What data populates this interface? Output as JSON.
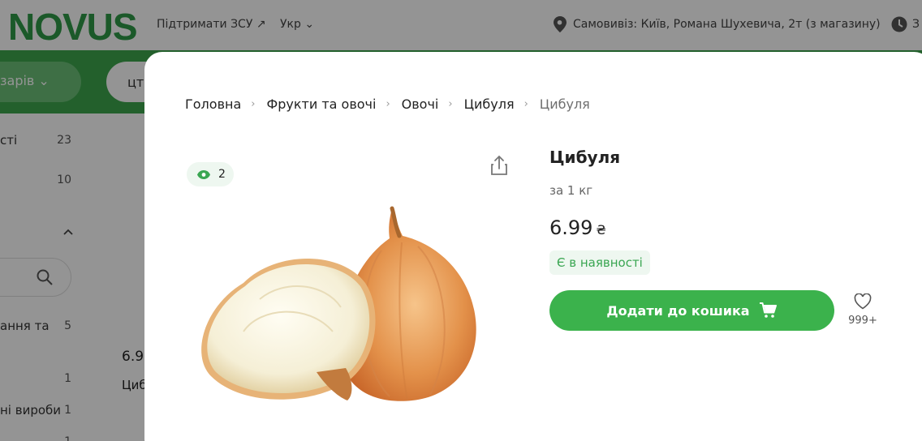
{
  "header": {
    "logo": "NOVUS",
    "support_link": "Підтримати ЗСУ ↗",
    "language": "Укр ⌄",
    "pickup": "Самовивіз: Київ, Романа Шухевича, 2т (з магазину)",
    "time_label": "З"
  },
  "catalog": {
    "catalog_button": "зарів ⌄",
    "search_text": "цт"
  },
  "sidebar": {
    "items": [
      {
        "label": "сті",
        "count": "23"
      },
      {
        "label": "",
        "count": "10"
      },
      {
        "label": "ання та",
        "count": "5"
      },
      {
        "label": "",
        "count": "1"
      },
      {
        "label": "ні вироби",
        "count": "1"
      },
      {
        "label": "",
        "count": "1"
      }
    ]
  },
  "background_card": {
    "price": "6.9",
    "name": "Циб"
  },
  "breadcrumb": [
    {
      "label": "Головна"
    },
    {
      "label": "Фрукти та овочі"
    },
    {
      "label": "Овочі"
    },
    {
      "label": "Цибуля"
    },
    {
      "label": "Цибуля"
    }
  ],
  "product": {
    "views": "2",
    "title": "Цибуля",
    "unit": "за 1 кг",
    "price": "6.99",
    "currency": "₴",
    "stock": "Є в наявності",
    "add_to_cart": "Додати до кошика",
    "favorites_count": "999+"
  },
  "icons": [
    "location-icon",
    "clock-icon",
    "search-icon",
    "eye-icon",
    "share-icon",
    "cart-icon",
    "heart-icon",
    "chevron-up-icon"
  ],
  "colors": {
    "brand_green": "#3bb24c",
    "logo_green": "#2f9a47",
    "stock_green": "#3aa652",
    "stock_bg": "#eef7f0"
  }
}
